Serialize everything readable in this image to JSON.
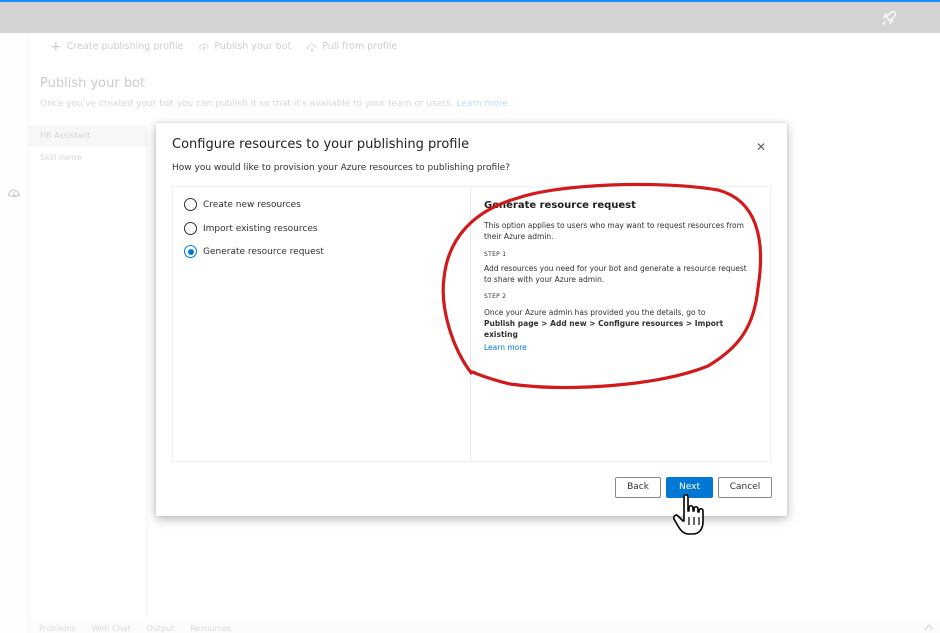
{
  "toolbar": {
    "create_profile": "Create publishing profile",
    "publish_bot": "Publish your bot",
    "pull_profile": "Pull from profile"
  },
  "page": {
    "title": "Publish your bot",
    "subtitle": "Once you've created your bot you can publish it so that it's available to your team or users.",
    "learn_more": "Learn more"
  },
  "nav": {
    "items": [
      {
        "label": "HR Assistant"
      },
      {
        "label": "Skill name"
      }
    ]
  },
  "bottom_tabs": [
    "Problems",
    "Web Chat",
    "Output",
    "Resources"
  ],
  "dialog": {
    "title": "Configure resources to your publishing profile",
    "subtitle": "How you would like to provision your Azure resources to publishing profile?",
    "options": [
      {
        "label": "Create new resources",
        "selected": false
      },
      {
        "label": "Import existing resources",
        "selected": false
      },
      {
        "label": "Generate resource request",
        "selected": true
      }
    ],
    "detail": {
      "title": "Generate resource request",
      "intro": "This option applies to users who may want to request resources from their Azure admin.",
      "step1_label": "STEP 1",
      "step1_text": "Add resources you need for your bot and generate a resource request to share with your Azure admin.",
      "step2_label": "STEP 2",
      "step2_text": "Once your Azure admin has provided you the details, go to",
      "step2_path": "Publish page > Add new > Configure resources > Import existing",
      "learn_more": "Learn more"
    },
    "buttons": {
      "back": "Back",
      "next": "Next",
      "cancel": "Cancel"
    }
  },
  "colors": {
    "accent": "#0078d4",
    "annotation": "#d11a1a"
  },
  "icons": {
    "rocket": "rocket-icon",
    "close": "close-icon",
    "cloud": "cloud-icon",
    "cursor": "hand-pointer-cursor"
  }
}
